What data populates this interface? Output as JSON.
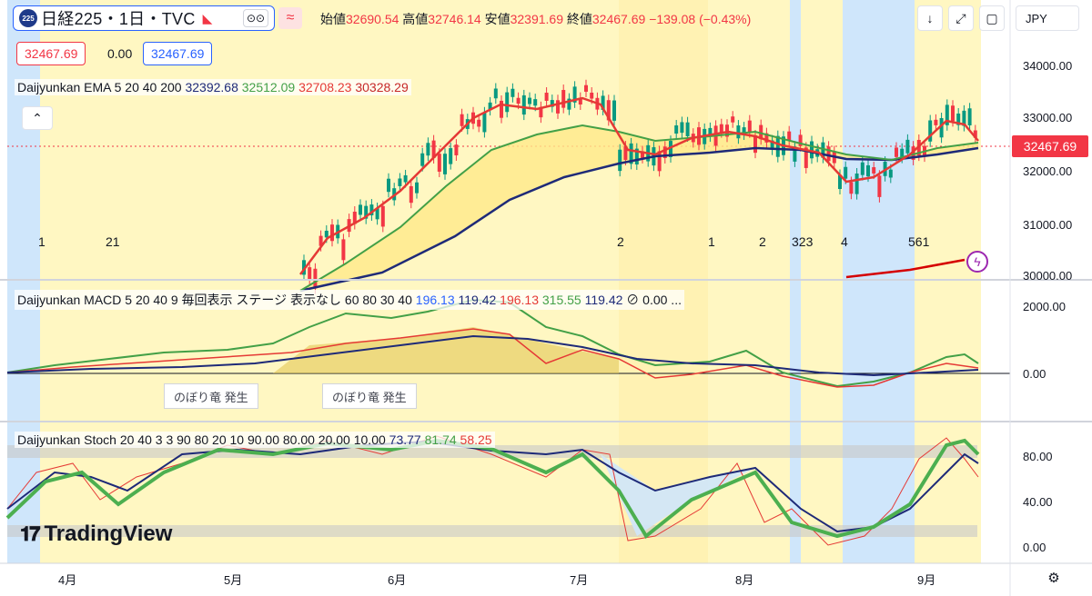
{
  "header": {
    "symbol_logo": "225",
    "symbol": "日経225・1日・TVC",
    "dots_icon": "⊙⊙",
    "wave_icon": "≈",
    "ohlc": [
      {
        "label": "始値",
        "value": "32690.54"
      },
      {
        "label": "高値",
        "value": "32746.14"
      },
      {
        "label": "安値",
        "value": "32391.69"
      },
      {
        "label": "終値",
        "value": "32467.69"
      },
      {
        "label": "",
        "value": "−139.08 (−0.43%)"
      }
    ],
    "currency": "JPY"
  },
  "price_boxes": {
    "sell": "32467.69",
    "spread": "0.00",
    "buy": "32467.69"
  },
  "legends": {
    "ema": {
      "name": "Daijyunkan EMA 5 20 40 200",
      "values": [
        {
          "v": "32392.68",
          "color": "#1e2a78"
        },
        {
          "v": "32512.09",
          "color": "#43a047"
        },
        {
          "v": "32708.23",
          "color": "#e53935"
        },
        {
          "v": "30328.29",
          "color": "#c62828"
        }
      ]
    },
    "macd": {
      "name": "Daijyunkan MACD 5 20 40 9 毎回表示 ステージ 表示なし 60 80 30 40",
      "values": [
        {
          "v": "196.13",
          "color": "#2962ff"
        },
        {
          "v": "119.42",
          "color": "#1e2a78"
        },
        {
          "v": "196.13",
          "color": "#e53935"
        },
        {
          "v": "315.55",
          "color": "#43a047"
        },
        {
          "v": "119.42",
          "color": "#1e2a78"
        },
        {
          "v": "⊘ 0.00 ...",
          "color": "#131722"
        }
      ]
    },
    "stoch": {
      "name": "Daijyunkan Stoch 20 40 3 3 90 80 20 10 90.00 80.00 20.00 10.00",
      "values": [
        {
          "v": "73.77",
          "color": "#1e2a78"
        },
        {
          "v": "81.74",
          "color": "#43a047"
        },
        {
          "v": "58.25",
          "color": "#e53935"
        }
      ]
    }
  },
  "price_axis": [
    "34000.00",
    "33000.00",
    "32000.00",
    "31000.00",
    "30000.00"
  ],
  "macd_axis": [
    "2000.00",
    "0.00"
  ],
  "stoch_axis": [
    "80.00",
    "40.00",
    "0.00"
  ],
  "last_price": "32467.69",
  "time_axis": [
    "4月",
    "5月",
    "6月",
    "7月",
    "8月",
    "9月"
  ],
  "stage_numbers": [
    {
      "text": "1"
    },
    {
      "text": "21"
    },
    {
      "text": "2"
    },
    {
      "text": "1"
    },
    {
      "text": "2"
    },
    {
      "text": "323"
    },
    {
      "text": "4"
    },
    {
      "text": "561"
    }
  ],
  "annotations": [
    "のぼり竜 発生",
    "のぼり竜 発生"
  ],
  "brand": "TradingView",
  "colors": {
    "accent": "#2962ff",
    "down": "#f23645",
    "up": "#089981",
    "ema_fast": "#e53935",
    "ema_mid": "#43a047",
    "ema_slow": "#1e2a78",
    "stage_yellow": "#fff7c2",
    "stage_blue": "#cfe6fb"
  }
}
